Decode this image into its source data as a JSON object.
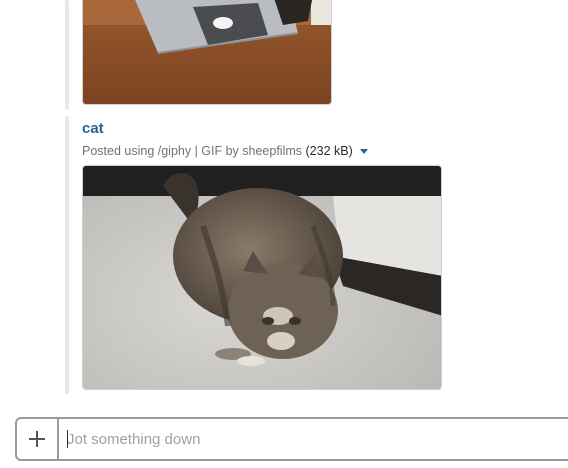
{
  "attachment": {
    "title": "cat",
    "meta_posted": "Posted using /giphy | GIF by sheepfilms",
    "meta_size": "(232 kB)"
  },
  "icons": {
    "composer_add": "plus-icon",
    "meta_menu": "caret-down-icon"
  },
  "composer": {
    "placeholder": "Jot something down",
    "value": ""
  },
  "colors": {
    "link": "#2a6490",
    "border": "#9b9b9b"
  }
}
